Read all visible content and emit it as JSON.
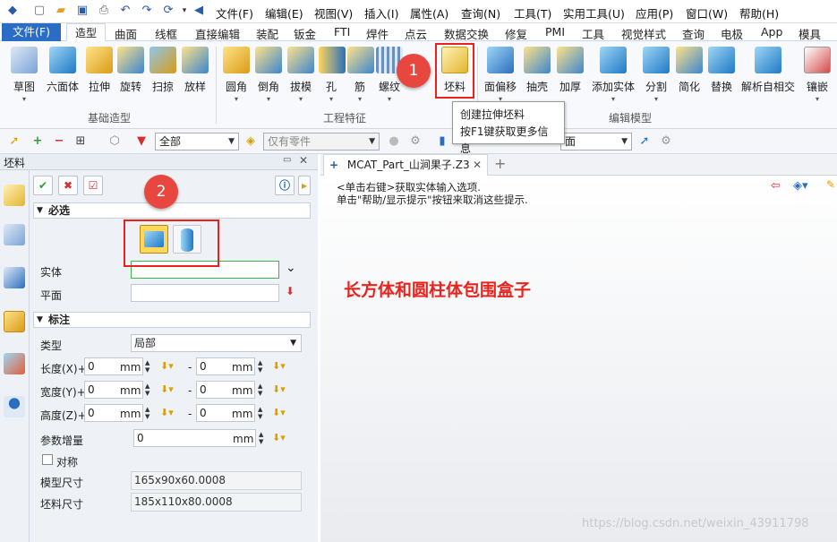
{
  "menubar": {
    "items": [
      "文件(F)",
      "编辑(E)",
      "视图(V)",
      "插入(I)",
      "属性(A)",
      "查询(N)",
      "工具(T)",
      "实用工具(U)",
      "应用(P)",
      "窗口(W)",
      "帮助(H)"
    ]
  },
  "tabs": {
    "file": "文件(F)",
    "items": [
      "造型",
      "曲面",
      "线框",
      "直接编辑",
      "装配",
      "钣金",
      "FTI",
      "焊件",
      "点云",
      "数据交换",
      "修复",
      "PMI",
      "工具",
      "视觉样式",
      "查询",
      "电极",
      "App",
      "模具"
    ]
  },
  "ribbon": {
    "basic": [
      "草图",
      "六面体",
      "拉伸",
      "旋转",
      "扫掠",
      "放样"
    ],
    "basic_group": "基础造型",
    "eng": [
      "圆角",
      "倒角",
      "拔模",
      "孔",
      "筋",
      "螺纹",
      "坯料"
    ],
    "eng_group": "工程特征",
    "edit": [
      "面偏移",
      "抽壳",
      "加厚",
      "添加实体",
      "分割",
      "简化",
      "替换",
      "解析自相交",
      "镶嵌"
    ],
    "edit_group": "编辑模型"
  },
  "tooltip": {
    "line1": "创建拉伸坯料",
    "line2": "按F1键获取更多信息"
  },
  "toolbar2": {
    "filter": "全部",
    "filter2": "仅有零件",
    "face": "面"
  },
  "panel": {
    "title": "坯料",
    "required": "必选",
    "solid_label": "实体",
    "plane_label": "平面",
    "annot": "标注",
    "type_label": "类型",
    "type_value": "局部",
    "length_label": "长度(X)+",
    "width_label": "宽度(Y)+",
    "height_label": "高度(Z)+",
    "val0": "0",
    "unit": "mm",
    "minus": "-",
    "increment_label": "参数增量",
    "symmetric": "对称",
    "model_size_label": "模型尺寸",
    "model_size": "165x90x60.0008",
    "blank_size_label": "坯料尺寸",
    "blank_size": "185x110x80.0008"
  },
  "doc": {
    "tab": "MCAT_Part_山涧果子.Z3",
    "plus": "+",
    "hint1": "<单击右键>获取实体输入选项.",
    "hint2": "单击\"帮助/显示提示\"按钮来取消这些提示."
  },
  "annotation": {
    "text": "长方体和圆柱体包围盒子",
    "badge1": "1",
    "badge2": "2"
  },
  "watermark": "https://blog.csdn.net/weixin_43911798",
  "colors": {
    "accent": "#2b6cc4",
    "highlight": "#e8231e"
  }
}
